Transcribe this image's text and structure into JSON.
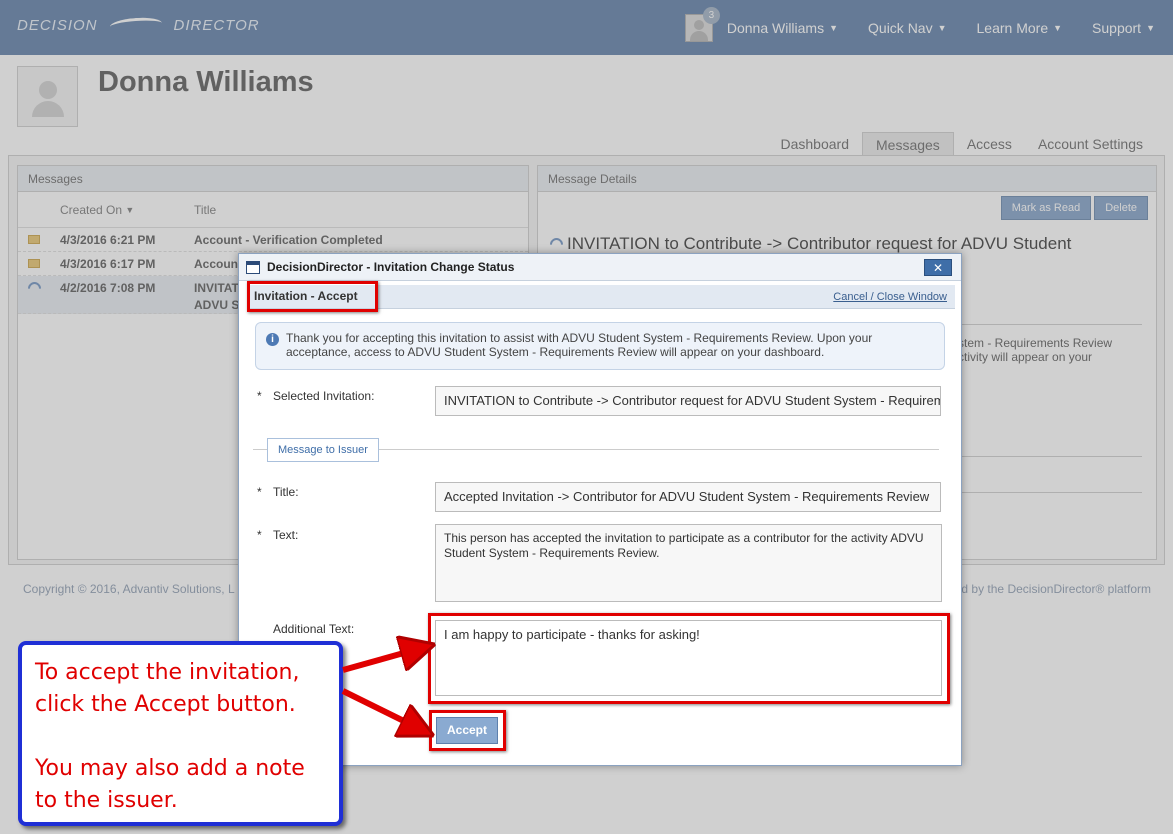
{
  "logo": {
    "left": "DECISION",
    "right": "DIRECTOR"
  },
  "topnav": {
    "notification_count": "3",
    "user": "Donna Williams",
    "quick_nav": "Quick Nav",
    "learn_more": "Learn More",
    "support": "Support"
  },
  "profile": {
    "name": "Donna Williams"
  },
  "tabs": [
    "Dashboard",
    "Messages",
    "Access",
    "Account Settings"
  ],
  "messages": {
    "header": "Messages",
    "col_created": "Created On",
    "col_title": "Title",
    "rows": [
      {
        "date": "4/3/2016 6:21 PM",
        "title": "Account - Verification Completed"
      },
      {
        "date": "4/3/2016 6:17 PM",
        "title": "Accoun"
      },
      {
        "date": "4/2/2016 7:08 PM",
        "title": "INVITAT",
        "title2": "ADVU S"
      }
    ]
  },
  "details": {
    "header": "Message Details",
    "mark_read": "Mark as Read",
    "delete": "Delete",
    "title": "INVITATION to Contribute -> Contributor request for ADVU Student",
    "body": "stem - Requirements Review\nctivity will appear on your"
  },
  "footer": {
    "left": "Copyright © 2016, Advantiv Solutions, L",
    "right": "d by the DecisionDirector® platform"
  },
  "modal": {
    "window_title": "DecisionDirector - Invitation Change Status",
    "close": "✕",
    "sub_title": "Invitation - Accept",
    "cancel": "Cancel / Close Window",
    "info": "Thank you for accepting this invitation to assist with ADVU Student System - Requirements Review. Upon your acceptance, access to ADVU Student System - Requirements Review will appear on your dashboard.",
    "required_mark": "*",
    "selected_label": "Selected Invitation:",
    "selected_value": "INVITATION to Contribute -> Contributor request for ADVU Student System - Requirements Review",
    "legend": "Message to Issuer",
    "title_label": "Title:",
    "title_value": "Accepted Invitation -> Contributor for ADVU Student System - Requirements Review",
    "text_label": "Text:",
    "text_value": "This person has accepted the invitation to participate as a contributor for the activity ADVU Student System - Requirements Review.",
    "additional_label": "Additional Text:",
    "additional_value": "I am happy to participate - thanks for asking!",
    "accept": "Accept"
  },
  "callout": {
    "line1": "To accept the invitation,",
    "line2": "click the Accept button.",
    "line3": "You may also add a note",
    "line4": "to the issuer."
  }
}
